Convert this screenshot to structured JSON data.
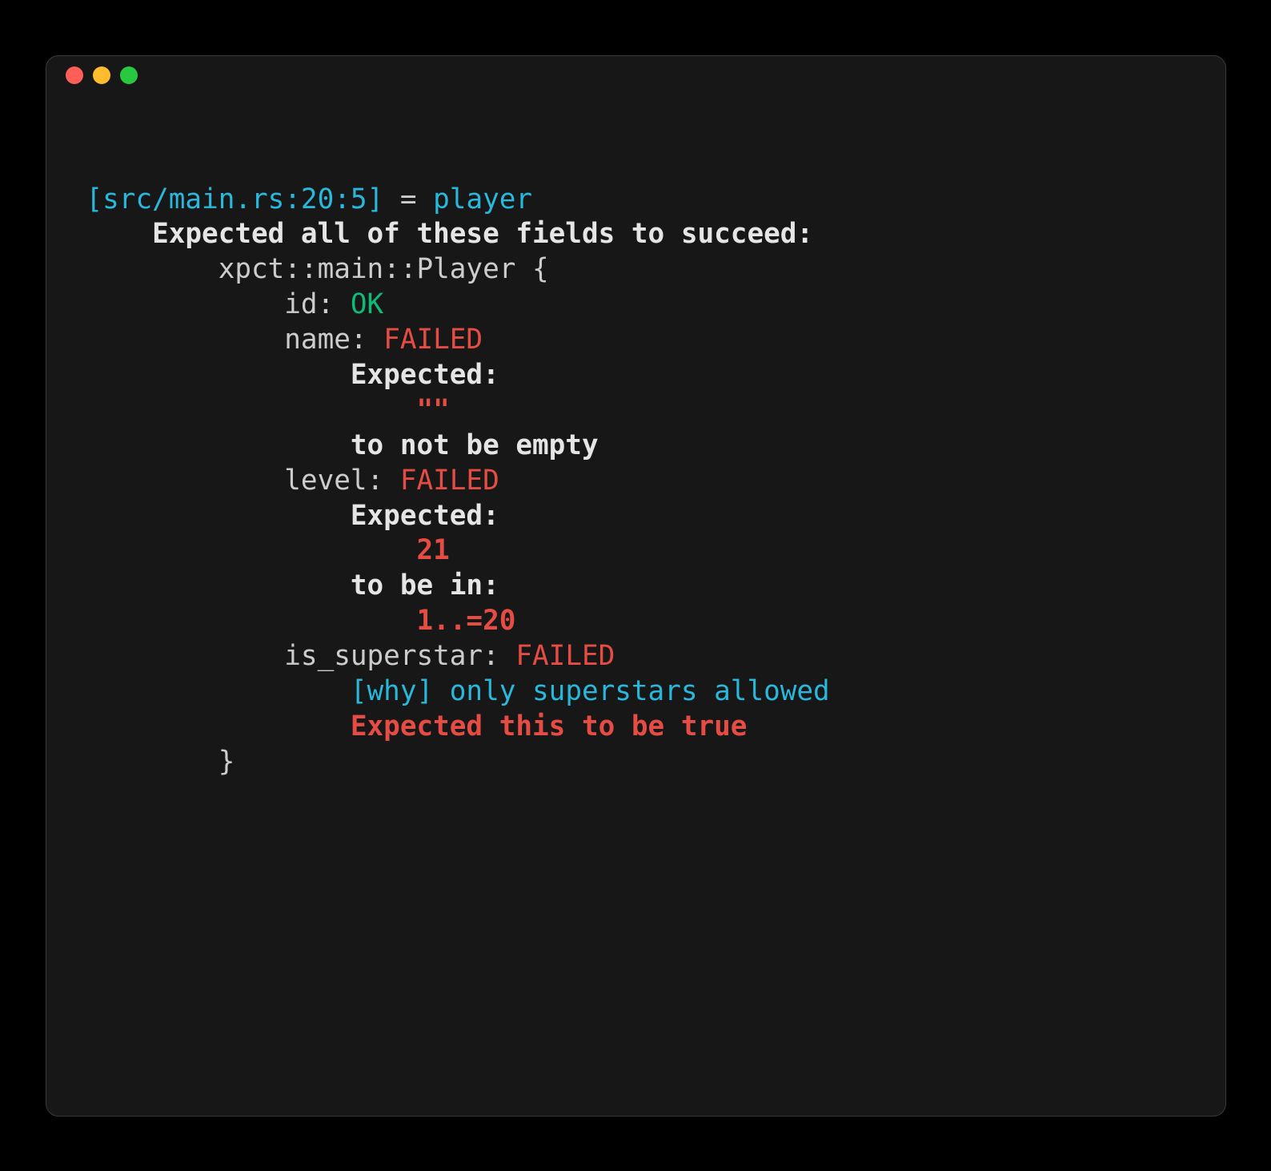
{
  "source_location": "[src/main.rs:20:5]",
  "equals": " = ",
  "binding": "player",
  "header": "    Expected all of these fields to succeed:",
  "struct_open": "        xpct::main::Player {",
  "fields": {
    "id": {
      "label": "            id: ",
      "status": "OK"
    },
    "name": {
      "label": "            name: ",
      "status": "FAILED",
      "expected_label": "                Expected:",
      "expected_value": "                    \"\"",
      "constraint": "                to not be empty"
    },
    "level": {
      "label": "            level: ",
      "status": "FAILED",
      "expected_label": "                Expected:",
      "expected_value": "                    21",
      "constraint_label": "                to be in:",
      "constraint_value": "                    1..=20"
    },
    "is_superstar": {
      "label": "            is_superstar: ",
      "status": "FAILED",
      "why_tag": "                [why]",
      "why_text": " only superstars allowed",
      "expected": "                Expected this to be true"
    }
  },
  "struct_close": "        }"
}
